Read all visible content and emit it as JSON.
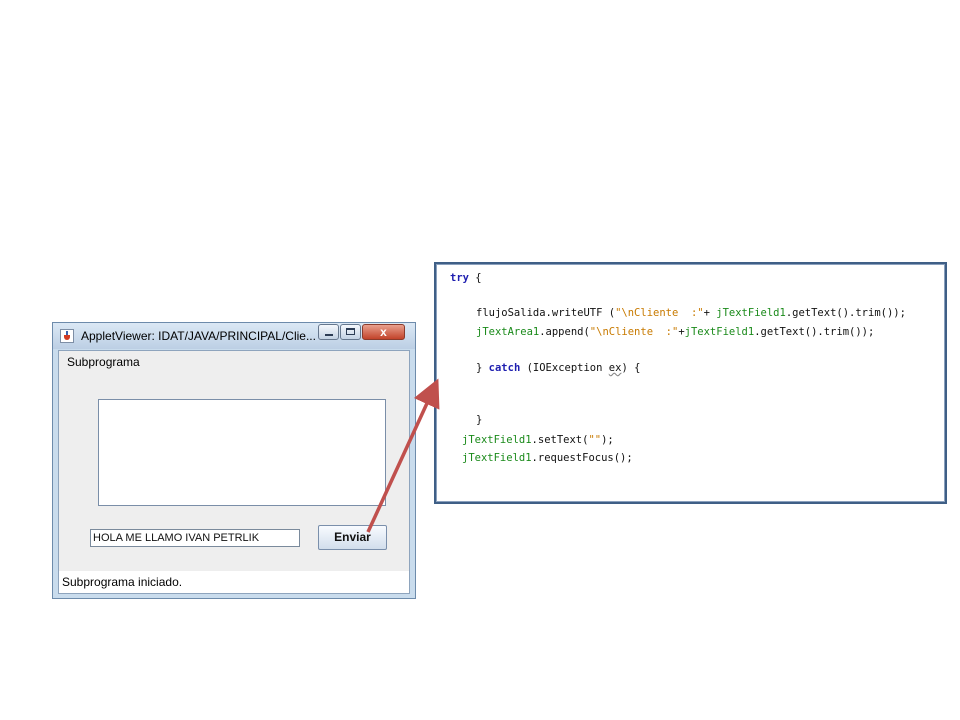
{
  "applet": {
    "title": "AppletViewer: IDAT/JAVA/PRINCIPAL/Clie...",
    "window_controls": {
      "close_glyph": "x"
    },
    "applet_name": "Subprograma",
    "text_field_value": "HOLA ME LLAMO IVAN PETRLIK",
    "send_button_label": "Enviar",
    "status": "Subprograma iniciado."
  },
  "code": {
    "try_kw": "try",
    "brace_open": "{",
    "l1_field": "flujoSalida",
    "l1_rest": ".writeUTF (",
    "l1_str": "\"\\nCliente  :\"",
    "l1_plus": "+",
    "l1_field2": "jTextField1",
    "l1_tail": ".getText().trim());",
    "l2_field": "jTextArea1",
    "l2_rest": ".append(",
    "l2_str": "\"\\nCliente  :\"",
    "l2_plus": "+",
    "l2_field2": "jTextField1",
    "l2_tail": ".getText().trim());",
    "catch_close": "}",
    "catch_kw": "catch",
    "catch_rest1": " (IOException ",
    "catch_var": "ex",
    "catch_rest2": ") {",
    "brace_close": "}",
    "l5_field": "jTextField1",
    "l5_rest": ".setText(",
    "l5_str": "\"\"",
    "l5_tail": ");",
    "l6_field": "jTextField1",
    "l6_tail": ".requestFocus();"
  },
  "colors": {
    "arrow": "#c0504d",
    "panel_border": "#3f5f86"
  }
}
